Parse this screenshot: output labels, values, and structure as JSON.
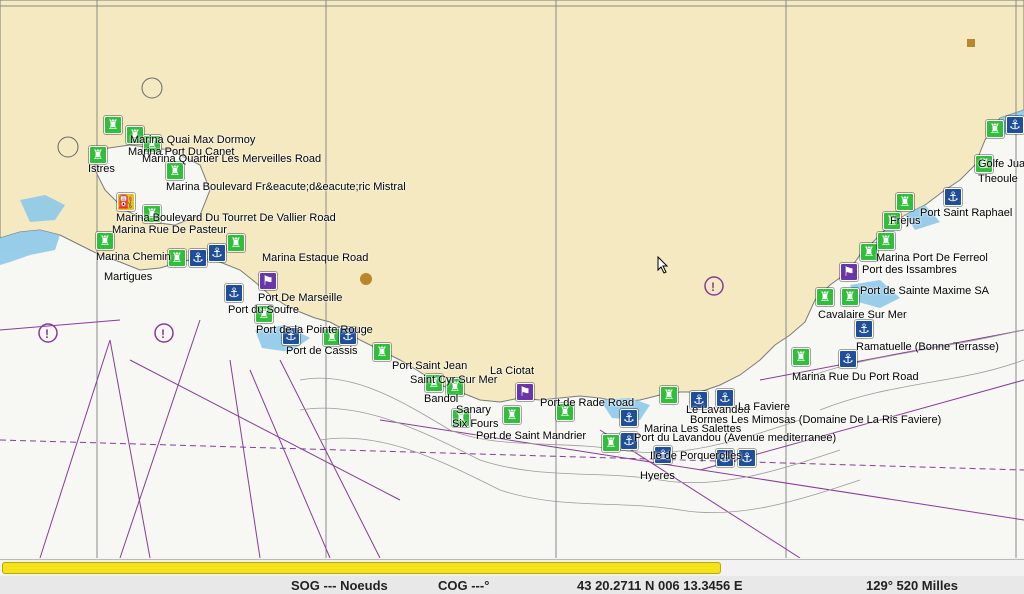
{
  "colors": {
    "land": "#f4e9c1",
    "sea": "#f7f7f4",
    "shallow": "#8ec9ea",
    "chart_lines": "#8a3a9a",
    "grid": "#8a8a8a",
    "marina": "#2fbf3a",
    "anchorage": "#1f4e9a",
    "harbour_office": "#6a35a8",
    "fuel": "#e8c21a"
  },
  "labels": [
    "Marina Quai Max Dormoy",
    "Marina Port Du Canet",
    "Marina Quartier Les Merveilles Road",
    "Istres",
    "Marina Boulevard Fr&eacute;d&eacute;ric Mistral",
    "Marina Boulevard Du Tourret De Vallier Road",
    "Marina Rue De Pasteur",
    "Martigues",
    "Marina Chemin",
    "Marina Estaque Road",
    "Port De Marseille",
    "Port du Soufre",
    "Port de la Pointe Rouge",
    "Port de Cassis",
    "Port Saint Jean",
    "La Ciotat",
    "Saint Cyr Sur Mer",
    "Bandol",
    "Sanary",
    "Six Fours",
    "Port de Rade Road",
    "Port de Saint Mandrier",
    "Marina Les Salettes",
    "Le Lavandou",
    "La Faviere",
    "Bormes Les Mimosas (Domaine De La Ris Faviere)",
    "Ile de Porquerolles",
    "Hyeres",
    "Port du Lavandou (Avenue mediterranee)",
    "Marina Rue Du Port Road",
    "Ramatuelle (Bonne Terrasse)",
    "Port de Sainte Maxime SA",
    "Port des Issambres",
    "Marina Port De Ferreol",
    "Frejus",
    "Port Saint Raphael",
    "Theoule",
    "Cavalaire Sur Mer",
    "Golfe Juan"
  ],
  "status_bar": {
    "sog": "SOG --- Noeuds",
    "cog": "COG ---°",
    "position": "43 20.2711 N 006 13.3456 E",
    "bearing_range": "129° 520 Milles"
  },
  "progress": {
    "fraction": 0.705
  }
}
